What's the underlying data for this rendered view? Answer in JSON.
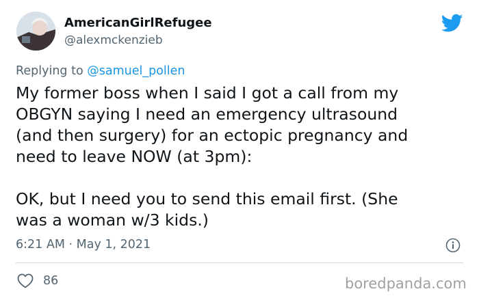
{
  "user": {
    "display_name": "AmericanGirlRefugee",
    "handle": "@alexmckenzieb"
  },
  "reply": {
    "prefix": "Replying to ",
    "mention": "@samuel_pollen"
  },
  "tweet": {
    "text": "My former boss when I said I got a call from my\nOBGYN saying I need an emergency ultrasound\n(and then surgery) for an ectopic pregnancy and\nneed to leave NOW (at 3pm):\n\nOK, but I need you to send this email first. (She\nwas a woman w/3 kids.)",
    "timestamp": "6:21 AM · May 1, 2021",
    "likes": "86"
  },
  "icons": {
    "brand": "twitter-bird-icon",
    "info": "info-icon",
    "like": "heart-icon"
  },
  "watermark": "boredpanda.com",
  "colors": {
    "twitter_blue": "#1d9bf0",
    "mention_blue": "#1b95e0",
    "secondary_text": "#536471",
    "primary_text": "#0f1419"
  }
}
